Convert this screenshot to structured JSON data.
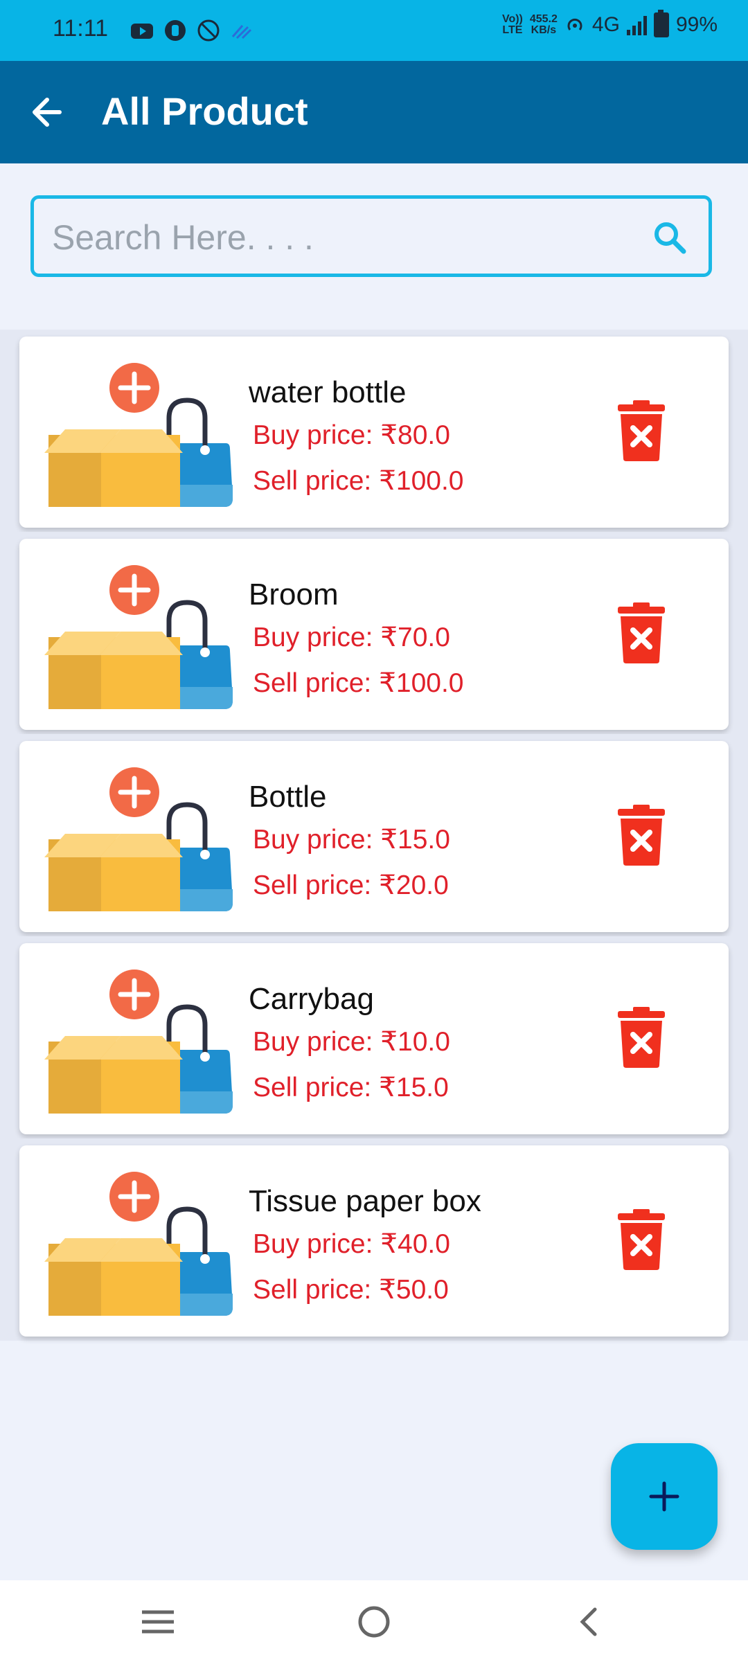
{
  "status_bar": {
    "time": "11:11",
    "net_top": "Vo))",
    "net_bottom": "LTE",
    "speed_top": "455.2",
    "speed_bottom": "KB/s",
    "network_type": "4G",
    "battery": "99%",
    "icons_left": [
      "youtube-icon",
      "app-icon",
      "vpn-icon",
      "signal-wave-icon"
    ]
  },
  "app_bar": {
    "title": "All Product",
    "back_icon": "arrow-left-icon"
  },
  "search": {
    "placeholder": "Search Here. . . .",
    "icon": "search-icon"
  },
  "products": [
    {
      "name": "water bottle",
      "buy": "Buy price: ₹80.0",
      "sell": "Sell price: ₹100.0"
    },
    {
      "name": "Broom",
      "buy": "Buy price: ₹70.0",
      "sell": "Sell price: ₹100.0"
    },
    {
      "name": "Bottle",
      "buy": "Buy price: ₹15.0",
      "sell": "Sell price: ₹20.0"
    },
    {
      "name": "Carrybag",
      "buy": "Buy price: ₹10.0",
      "sell": "Sell price: ₹15.0"
    },
    {
      "name": "Tissue paper box",
      "buy": "Buy price: ₹40.0",
      "sell": "Sell price: ₹50.0"
    }
  ],
  "fab": {
    "icon": "plus-icon"
  },
  "nav_bar": {
    "icons": [
      "menu-icon",
      "home-icon",
      "back-icon"
    ]
  },
  "colors": {
    "status_bar": "#08b4e6",
    "app_bar": "#02679e",
    "price_text": "#e0202a",
    "delete_icon": "#f0301e",
    "fab": "#08b4e6"
  }
}
